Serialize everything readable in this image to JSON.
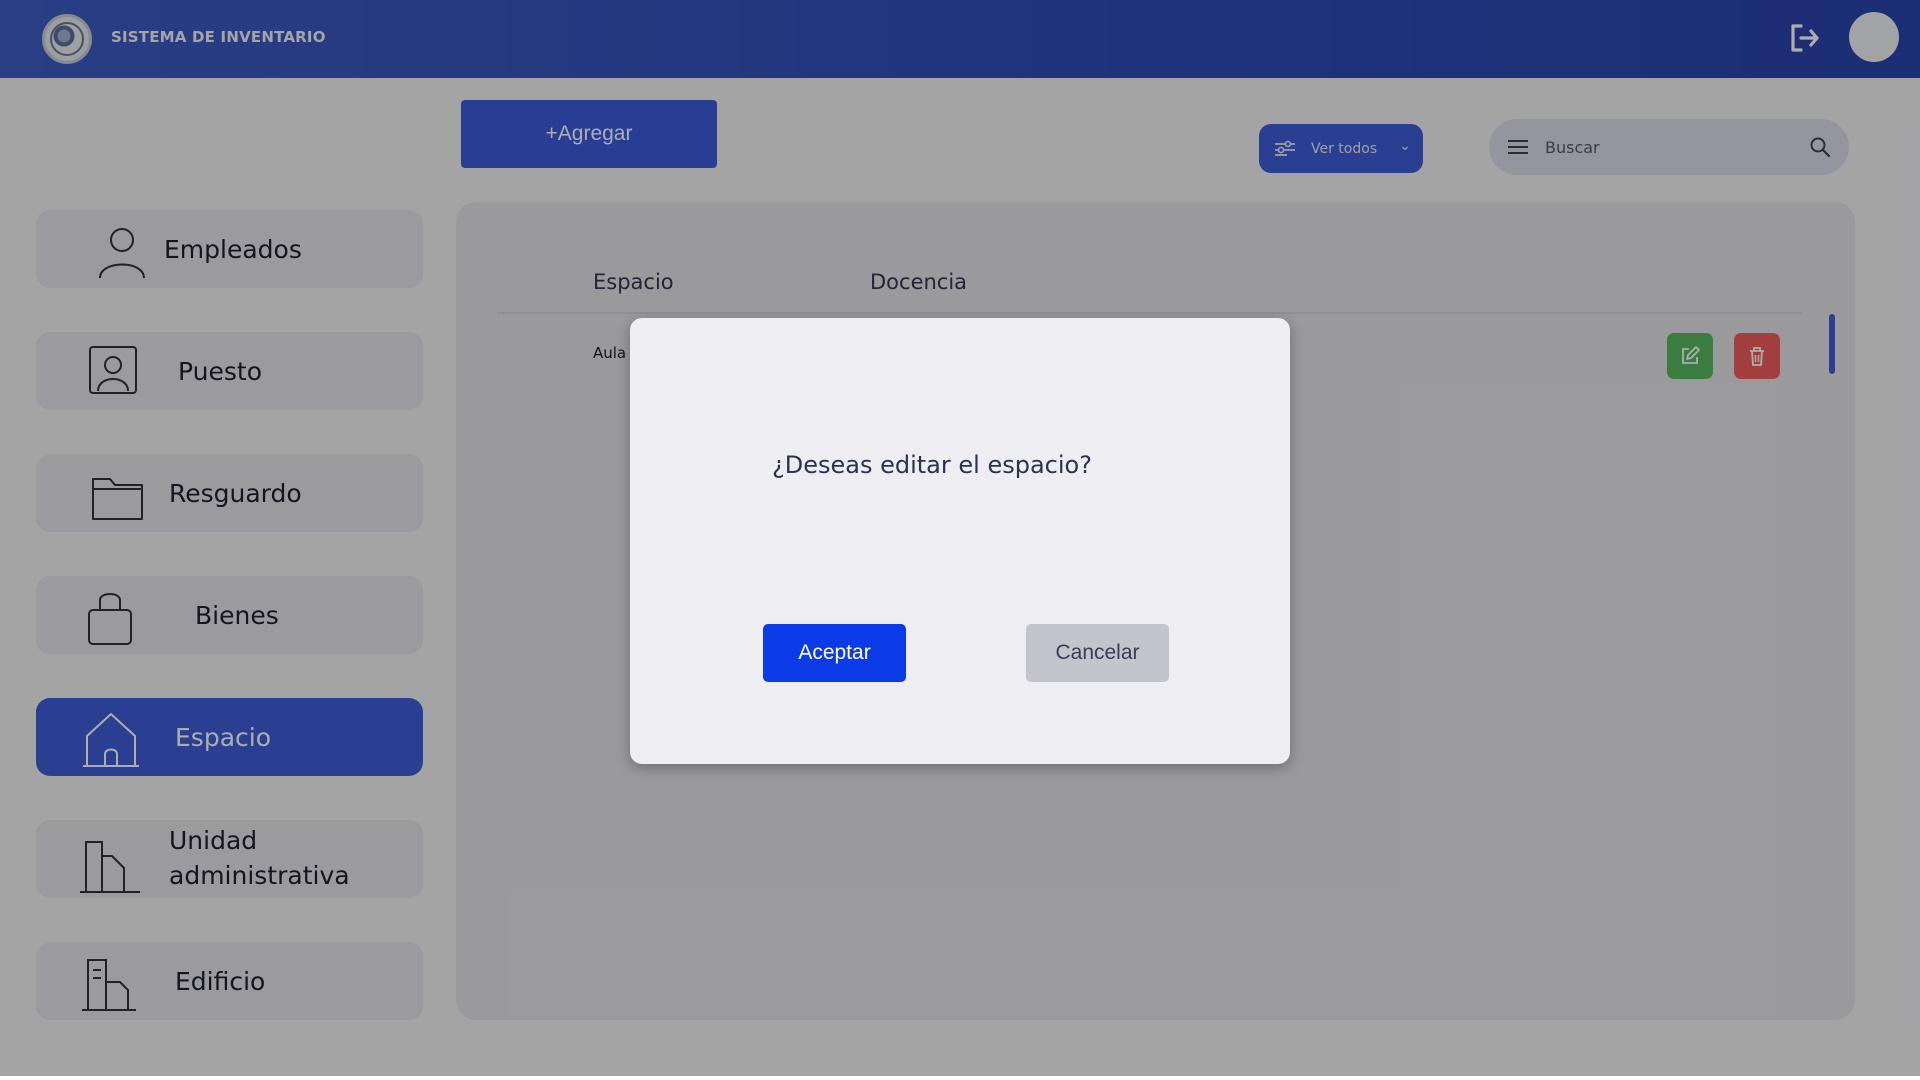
{
  "header": {
    "title": "SISTEMA DE INVENTARIO"
  },
  "toolbar": {
    "add_label": "+Agregar",
    "filter_label": "Ver todos",
    "search_placeholder": "Buscar"
  },
  "sidebar": {
    "items": [
      {
        "label": "Empleados",
        "icon": "person-icon"
      },
      {
        "label": "Puesto",
        "icon": "id-badge-icon"
      },
      {
        "label": "Resguardo",
        "icon": "folder-icon"
      },
      {
        "label": "Bienes",
        "icon": "bag-icon"
      },
      {
        "label": "Espacio",
        "icon": "house-icon",
        "active": true
      },
      {
        "label": "Unidad administrativa",
        "icon": "buildings-icon"
      },
      {
        "label": "Edificio",
        "icon": "building-icon"
      }
    ]
  },
  "table": {
    "columns": [
      "Espacio",
      "Docencia"
    ],
    "rows": [
      {
        "espacio": "Aula"
      }
    ]
  },
  "modal": {
    "question": "¿Deseas editar el espacio?",
    "accept_label": "Aceptar",
    "cancel_label": "Cancelar"
  },
  "colors": {
    "primary": "#3b5bdb",
    "accept": "#0a3be6",
    "edit": "#58b85f",
    "delete": "#f05c5c"
  }
}
